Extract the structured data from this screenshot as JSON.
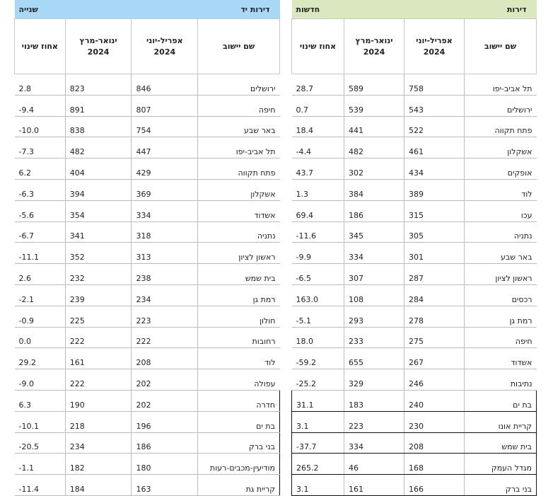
{
  "left_table": {
    "title_a": "דירות יד",
    "title_b": "שנייה",
    "headers": {
      "name": "שם יישוב",
      "apr_jun": "אפריל-יוני 2024",
      "jan_mar": "ינואר-מרץ 2024",
      "pct": "אחוז שינוי"
    },
    "rows": [
      {
        "name": "ירושלים",
        "a": "846",
        "b": "823",
        "p": "2.8"
      },
      {
        "name": "חיפה",
        "a": "807",
        "b": "891",
        "p": "9.4-"
      },
      {
        "name": "באר שבע",
        "a": "754",
        "b": "838",
        "p": "10.0-"
      },
      {
        "name": "תל אביב-יפו",
        "a": "447",
        "b": "482",
        "p": "7.3-"
      },
      {
        "name": "פתח תקווה",
        "a": "429",
        "b": "404",
        "p": "6.2"
      },
      {
        "name": "אשקלון",
        "a": "369",
        "b": "394",
        "p": "6.3-"
      },
      {
        "name": "אשדוד",
        "a": "334",
        "b": "354",
        "p": "5.6-"
      },
      {
        "name": "נתניה",
        "a": "318",
        "b": "341",
        "p": "6.7-"
      },
      {
        "name": "ראשון לציון",
        "a": "313",
        "b": "352",
        "p": "11.1-"
      },
      {
        "name": "בית שמש",
        "a": "238",
        "b": "232",
        "p": "2.6"
      },
      {
        "name": "רמת גן",
        "a": "234",
        "b": "239",
        "p": "2.1-"
      },
      {
        "name": "חולון",
        "a": "223",
        "b": "225",
        "p": "0.9-"
      },
      {
        "name": "רחובות",
        "a": "222",
        "b": "222",
        "p": "0.0"
      },
      {
        "name": "לוד",
        "a": "208",
        "b": "161",
        "p": "29.2"
      },
      {
        "name": "עפולה",
        "a": "202",
        "b": "222",
        "p": "9.0-"
      },
      {
        "name": "חדרה",
        "a": "202",
        "b": "190",
        "p": "6.3"
      },
      {
        "name": "בת ים",
        "a": "196",
        "b": "218",
        "p": "10.1-"
      },
      {
        "name": "בני ברק",
        "a": "186",
        "b": "234",
        "p": "20.5-"
      },
      {
        "name": "מודיעין-מכבים-רעות",
        "a": "180",
        "b": "182",
        "p": "1.1-"
      },
      {
        "name": "קריית גת",
        "a": "163",
        "b": "184",
        "p": "11.4-"
      }
    ]
  },
  "right_table": {
    "title_a": "דירות",
    "title_b": "חדשות",
    "headers": {
      "name": "שם יישוב",
      "apr_jun": "אפריל-יוני 2024",
      "jan_mar": "ינואר-מרץ 2024",
      "pct": "אחוז שינוי"
    },
    "rows": [
      {
        "name": "תל אביב-יפו",
        "a": "758",
        "b": "589",
        "p": "28.7"
      },
      {
        "name": "ירושלים",
        "a": "543",
        "b": "539",
        "p": "0.7"
      },
      {
        "name": "פתח תקווה",
        "a": "522",
        "b": "441",
        "p": "18.4"
      },
      {
        "name": "אשקלון",
        "a": "461",
        "b": "482",
        "p": "4.4-"
      },
      {
        "name": "אופקים",
        "a": "434",
        "b": "302",
        "p": "43.7"
      },
      {
        "name": "לוד",
        "a": "389",
        "b": "384",
        "p": "1.3"
      },
      {
        "name": "עכו",
        "a": "315",
        "b": "186",
        "p": "69.4"
      },
      {
        "name": "נתניה",
        "a": "305",
        "b": "345",
        "p": "11.6-"
      },
      {
        "name": "באר שבע",
        "a": "301",
        "b": "334",
        "p": "9.9-"
      },
      {
        "name": "ראשון לציון",
        "a": "287",
        "b": "307",
        "p": "6.5-"
      },
      {
        "name": "רכסים",
        "a": "284",
        "b": "108",
        "p": "163.0"
      },
      {
        "name": "רמת גן",
        "a": "278",
        "b": "293",
        "p": "5.1-"
      },
      {
        "name": "חיפה",
        "a": "275",
        "b": "233",
        "p": "18.0"
      },
      {
        "name": "אשדוד",
        "a": "267",
        "b": "655",
        "p": "59.2-"
      },
      {
        "name": "נתיבות",
        "a": "246",
        "b": "329",
        "p": "25.2-"
      },
      {
        "name": "בת ים",
        "a": "240",
        "b": "183",
        "p": "31.1"
      },
      {
        "name": "קריית אונו",
        "a": "230",
        "b": "223",
        "p": "3.1"
      },
      {
        "name": "בית שמש",
        "a": "208",
        "b": "334",
        "p": "37.7-"
      },
      {
        "name": "מגדל העמק",
        "a": "168",
        "b": "46",
        "p": "265.2"
      },
      {
        "name": "בני ברק",
        "a": "166",
        "b": "161",
        "p": "3.1"
      }
    ]
  }
}
